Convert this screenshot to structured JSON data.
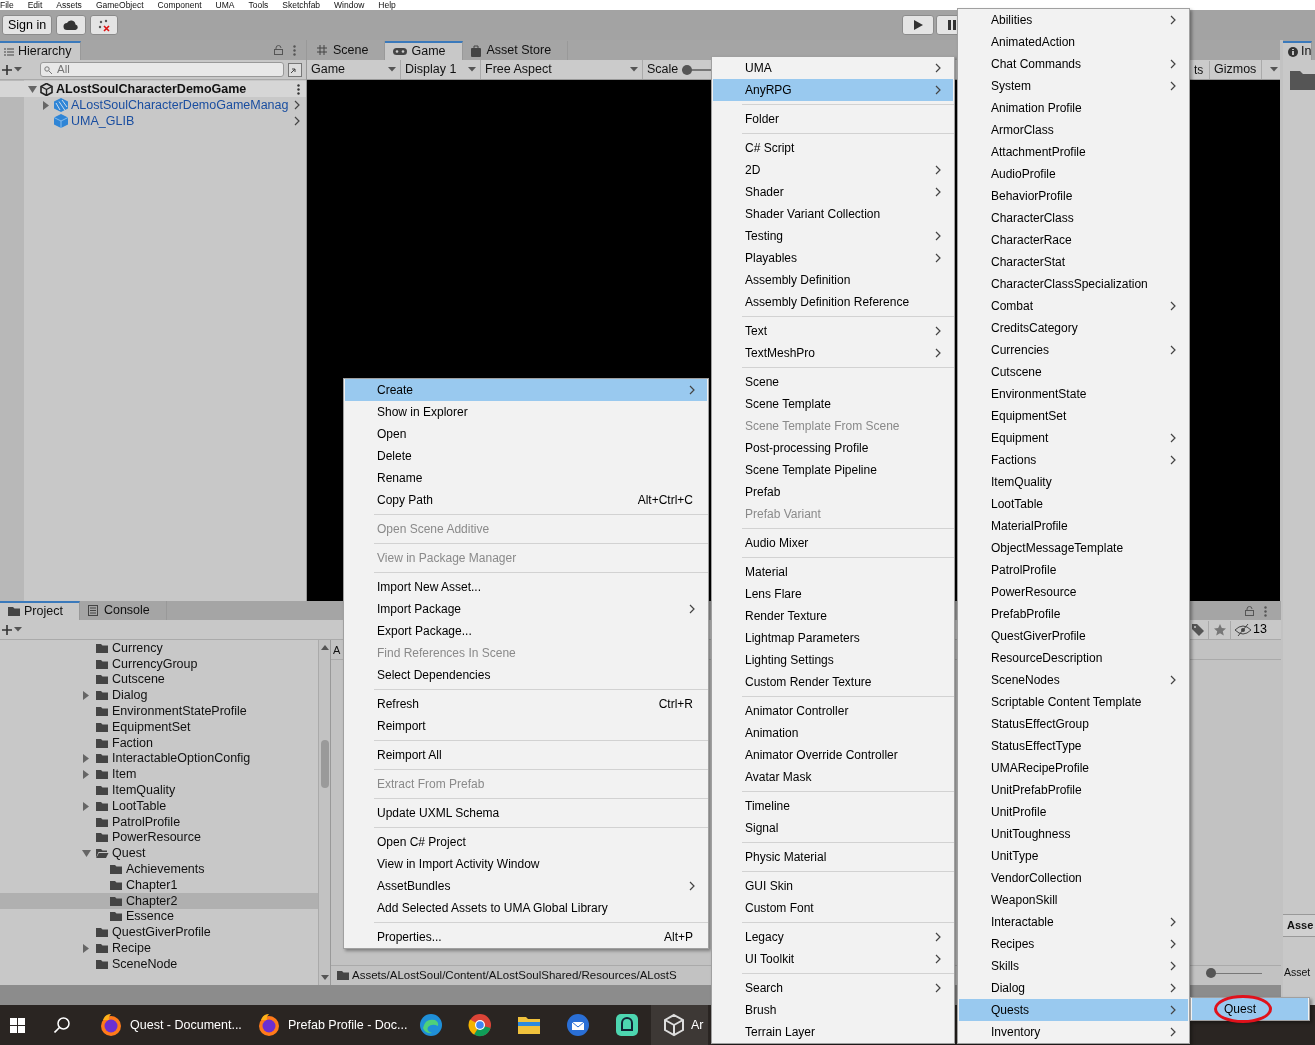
{
  "menu_bar": [
    "File",
    "Edit",
    "Assets",
    "GameObject",
    "Component",
    "UMA",
    "Tools",
    "Sketchfab",
    "Window",
    "Help"
  ],
  "toolbar": {
    "sign_in": "Sign in"
  },
  "hierarchy": {
    "title": "Hierarchy",
    "search_placeholder": "All",
    "tree": [
      {
        "name": "ALostSoulCharacterDemoGame",
        "kind": "scene",
        "expandable": true,
        "expanded": true,
        "children": [
          {
            "name": "ALostSoulCharacterDemoGameManag",
            "kind": "variant",
            "expandable": true,
            "expanded": false
          },
          {
            "name": "UMA_GLIB",
            "kind": "prefab",
            "expandable": false
          }
        ]
      }
    ]
  },
  "game_view": {
    "tabs": [
      {
        "label": "Scene",
        "kind": "grid",
        "selected": false
      },
      {
        "label": "Game",
        "kind": "pad",
        "selected": true
      },
      {
        "label": "Asset Store",
        "kind": "bag",
        "selected": false
      }
    ],
    "mode": "Game",
    "display": "Display 1",
    "aspect": "Free Aspect",
    "scale_label": "Scale",
    "scale_slider": {
      "level": 0
    },
    "stats": "ts",
    "gizmos": "Gizmos"
  },
  "inspector": {
    "title": "In",
    "section_heading": "Asse",
    "label": "Asset"
  },
  "project": {
    "tabs": [
      {
        "label": "Project",
        "kind": "folder",
        "selected": true
      },
      {
        "label": "Console",
        "kind": "console",
        "selected": false
      }
    ],
    "hidden_count": "13",
    "column_label": "A",
    "path": "Assets/ALostSoul/Content/ALostSoulShared/Resources/ALostS",
    "zoom_slider": {
      "level": 0
    },
    "tree": [
      {
        "name": "Currency",
        "expandable": false,
        "expanded": false,
        "selected": false
      },
      {
        "name": "CurrencyGroup",
        "expandable": false,
        "expanded": false,
        "selected": false
      },
      {
        "name": "Cutscene",
        "expandable": false,
        "expanded": false,
        "selected": false
      },
      {
        "name": "Dialog",
        "expandable": true,
        "expanded": false,
        "selected": false
      },
      {
        "name": "EnvironmentStateProfile",
        "expandable": false,
        "expanded": false,
        "selected": false
      },
      {
        "name": "EquipmentSet",
        "expandable": false,
        "expanded": false,
        "selected": false
      },
      {
        "name": "Faction",
        "expandable": false,
        "expanded": false,
        "selected": false
      },
      {
        "name": "InteractableOptionConfig",
        "expandable": true,
        "expanded": false,
        "selected": false
      },
      {
        "name": "Item",
        "expandable": true,
        "expanded": false,
        "selected": false
      },
      {
        "name": "ItemQuality",
        "expandable": false,
        "expanded": false,
        "selected": false
      },
      {
        "name": "LootTable",
        "expandable": true,
        "expanded": false,
        "selected": false
      },
      {
        "name": "PatrolProfile",
        "expandable": false,
        "expanded": false,
        "selected": false
      },
      {
        "name": "PowerResource",
        "expandable": false,
        "expanded": false,
        "selected": false
      },
      {
        "name": "Quest",
        "expandable": true,
        "expanded": true,
        "selected": false,
        "children": [
          {
            "name": "Achievements",
            "expandable": false,
            "expanded": false,
            "selected": false
          },
          {
            "name": "Chapter1",
            "expandable": false,
            "expanded": false,
            "selected": false
          },
          {
            "name": "Chapter2",
            "expandable": false,
            "expanded": false,
            "selected": true
          },
          {
            "name": "Essence",
            "expandable": false,
            "expanded": false,
            "selected": false
          }
        ]
      },
      {
        "name": "QuestGiverProfile",
        "expandable": false,
        "expanded": false,
        "selected": false
      },
      {
        "name": "Recipe",
        "expandable": true,
        "expanded": false,
        "selected": false
      },
      {
        "name": "SceneNode",
        "expandable": false,
        "expanded": false,
        "selected": false
      }
    ]
  },
  "context_menu": {
    "items": [
      {
        "kind": "item",
        "label": "Create",
        "submenu": true,
        "selected": true,
        "disabled": false
      },
      {
        "kind": "item",
        "label": "Show in Explorer",
        "submenu": false,
        "selected": false,
        "disabled": false
      },
      {
        "kind": "item",
        "label": "Open",
        "submenu": false,
        "selected": false,
        "disabled": false
      },
      {
        "kind": "item",
        "label": "Delete",
        "submenu": false,
        "selected": false,
        "disabled": false
      },
      {
        "kind": "item",
        "label": "Rename",
        "submenu": false,
        "selected": false,
        "disabled": false
      },
      {
        "kind": "item",
        "label": "Copy Path",
        "shortcut": "Alt+Ctrl+C",
        "submenu": false,
        "selected": false,
        "disabled": false
      },
      {
        "kind": "separator"
      },
      {
        "kind": "item",
        "label": "Open Scene Additive",
        "submenu": false,
        "selected": false,
        "disabled": true
      },
      {
        "kind": "separator"
      },
      {
        "kind": "item",
        "label": "View in Package Manager",
        "submenu": false,
        "selected": false,
        "disabled": true
      },
      {
        "kind": "separator"
      },
      {
        "kind": "item",
        "label": "Import New Asset...",
        "submenu": false,
        "selected": false,
        "disabled": false
      },
      {
        "kind": "item",
        "label": "Import Package",
        "submenu": true,
        "selected": false,
        "disabled": false
      },
      {
        "kind": "item",
        "label": "Export Package...",
        "submenu": false,
        "selected": false,
        "disabled": false
      },
      {
        "kind": "item",
        "label": "Find References In Scene",
        "submenu": false,
        "selected": false,
        "disabled": true
      },
      {
        "kind": "item",
        "label": "Select Dependencies",
        "submenu": false,
        "selected": false,
        "disabled": false
      },
      {
        "kind": "separator"
      },
      {
        "kind": "item",
        "label": "Refresh",
        "shortcut": "Ctrl+R",
        "submenu": false,
        "selected": false,
        "disabled": false
      },
      {
        "kind": "item",
        "label": "Reimport",
        "submenu": false,
        "selected": false,
        "disabled": false
      },
      {
        "kind": "separator"
      },
      {
        "kind": "item",
        "label": "Reimport All",
        "submenu": false,
        "selected": false,
        "disabled": false
      },
      {
        "kind": "separator"
      },
      {
        "kind": "item",
        "label": "Extract From Prefab",
        "submenu": false,
        "selected": false,
        "disabled": true
      },
      {
        "kind": "separator"
      },
      {
        "kind": "item",
        "label": "Update UXML Schema",
        "submenu": false,
        "selected": false,
        "disabled": false
      },
      {
        "kind": "separator"
      },
      {
        "kind": "item",
        "label": "Open C# Project",
        "submenu": false,
        "selected": false,
        "disabled": false
      },
      {
        "kind": "item",
        "label": "View in Import Activity Window",
        "submenu": false,
        "selected": false,
        "disabled": false
      },
      {
        "kind": "item",
        "label": "AssetBundles",
        "submenu": true,
        "selected": false,
        "disabled": false
      },
      {
        "kind": "item",
        "label": "Add Selected Assets to UMA Global Library",
        "submenu": false,
        "selected": false,
        "disabled": false
      },
      {
        "kind": "separator"
      },
      {
        "kind": "item",
        "label": "Properties...",
        "shortcut": "Alt+P",
        "submenu": false,
        "selected": false,
        "disabled": false
      }
    ]
  },
  "create_menu": {
    "items": [
      {
        "kind": "item",
        "label": "UMA",
        "submenu": true,
        "selected": false,
        "disabled": false
      },
      {
        "kind": "item",
        "label": "AnyRPG",
        "submenu": true,
        "selected": true,
        "disabled": false
      },
      {
        "kind": "separator"
      },
      {
        "kind": "item",
        "label": "Folder",
        "submenu": false,
        "selected": false,
        "disabled": false
      },
      {
        "kind": "separator"
      },
      {
        "kind": "item",
        "label": "C# Script",
        "submenu": false,
        "selected": false,
        "disabled": false
      },
      {
        "kind": "item",
        "label": "2D",
        "submenu": true,
        "selected": false,
        "disabled": false
      },
      {
        "kind": "item",
        "label": "Shader",
        "submenu": true,
        "selected": false,
        "disabled": false
      },
      {
        "kind": "item",
        "label": "Shader Variant Collection",
        "submenu": false,
        "selected": false,
        "disabled": false
      },
      {
        "kind": "item",
        "label": "Testing",
        "submenu": true,
        "selected": false,
        "disabled": false
      },
      {
        "kind": "item",
        "label": "Playables",
        "submenu": true,
        "selected": false,
        "disabled": false
      },
      {
        "kind": "item",
        "label": "Assembly Definition",
        "submenu": false,
        "selected": false,
        "disabled": false
      },
      {
        "kind": "item",
        "label": "Assembly Definition Reference",
        "submenu": false,
        "selected": false,
        "disabled": false
      },
      {
        "kind": "separator"
      },
      {
        "kind": "item",
        "label": "Text",
        "submenu": true,
        "selected": false,
        "disabled": false
      },
      {
        "kind": "item",
        "label": "TextMeshPro",
        "submenu": true,
        "selected": false,
        "disabled": false
      },
      {
        "kind": "separator"
      },
      {
        "kind": "item",
        "label": "Scene",
        "submenu": false,
        "selected": false,
        "disabled": false
      },
      {
        "kind": "item",
        "label": "Scene Template",
        "submenu": false,
        "selected": false,
        "disabled": false
      },
      {
        "kind": "item",
        "label": "Scene Template From Scene",
        "submenu": false,
        "selected": false,
        "disabled": true
      },
      {
        "kind": "item",
        "label": "Post-processing Profile",
        "submenu": false,
        "selected": false,
        "disabled": false
      },
      {
        "kind": "item",
        "label": "Scene Template Pipeline",
        "submenu": false,
        "selected": false,
        "disabled": false
      },
      {
        "kind": "item",
        "label": "Prefab",
        "submenu": false,
        "selected": false,
        "disabled": false
      },
      {
        "kind": "item",
        "label": "Prefab Variant",
        "submenu": false,
        "selected": false,
        "disabled": true
      },
      {
        "kind": "separator"
      },
      {
        "kind": "item",
        "label": "Audio Mixer",
        "submenu": false,
        "selected": false,
        "disabled": false
      },
      {
        "kind": "separator"
      },
      {
        "kind": "item",
        "label": "Material",
        "submenu": false,
        "selected": false,
        "disabled": false
      },
      {
        "kind": "item",
        "label": "Lens Flare",
        "submenu": false,
        "selected": false,
        "disabled": false
      },
      {
        "kind": "item",
        "label": "Render Texture",
        "submenu": false,
        "selected": false,
        "disabled": false
      },
      {
        "kind": "item",
        "label": "Lightmap Parameters",
        "submenu": false,
        "selected": false,
        "disabled": false
      },
      {
        "kind": "item",
        "label": "Lighting Settings",
        "submenu": false,
        "selected": false,
        "disabled": false
      },
      {
        "kind": "item",
        "label": "Custom Render Texture",
        "submenu": false,
        "selected": false,
        "disabled": false
      },
      {
        "kind": "separator"
      },
      {
        "kind": "item",
        "label": "Animator Controller",
        "submenu": false,
        "selected": false,
        "disabled": false
      },
      {
        "kind": "item",
        "label": "Animation",
        "submenu": false,
        "selected": false,
        "disabled": false
      },
      {
        "kind": "item",
        "label": "Animator Override Controller",
        "submenu": false,
        "selected": false,
        "disabled": false
      },
      {
        "kind": "item",
        "label": "Avatar Mask",
        "submenu": false,
        "selected": false,
        "disabled": false
      },
      {
        "kind": "separator"
      },
      {
        "kind": "item",
        "label": "Timeline",
        "submenu": false,
        "selected": false,
        "disabled": false
      },
      {
        "kind": "item",
        "label": "Signal",
        "submenu": false,
        "selected": false,
        "disabled": false
      },
      {
        "kind": "separator"
      },
      {
        "kind": "item",
        "label": "Physic Material",
        "submenu": false,
        "selected": false,
        "disabled": false
      },
      {
        "kind": "separator"
      },
      {
        "kind": "item",
        "label": "GUI Skin",
        "submenu": false,
        "selected": false,
        "disabled": false
      },
      {
        "kind": "item",
        "label": "Custom Font",
        "submenu": false,
        "selected": false,
        "disabled": false
      },
      {
        "kind": "separator"
      },
      {
        "kind": "item",
        "label": "Legacy",
        "submenu": true,
        "selected": false,
        "disabled": false
      },
      {
        "kind": "item",
        "label": "UI Toolkit",
        "submenu": true,
        "selected": false,
        "disabled": false
      },
      {
        "kind": "separator"
      },
      {
        "kind": "item",
        "label": "Search",
        "submenu": true,
        "selected": false,
        "disabled": false
      },
      {
        "kind": "item",
        "label": "Brush",
        "submenu": false,
        "selected": false,
        "disabled": false
      },
      {
        "kind": "item",
        "label": "Terrain Layer",
        "submenu": false,
        "selected": false,
        "disabled": false
      }
    ]
  },
  "anyrpg_menu": {
    "items": [
      {
        "kind": "item",
        "label": "Abilities",
        "submenu": true,
        "selected": false,
        "disabled": false
      },
      {
        "kind": "item",
        "label": "AnimatedAction",
        "submenu": false,
        "selected": false,
        "disabled": false
      },
      {
        "kind": "item",
        "label": "Chat Commands",
        "submenu": true,
        "selected": false,
        "disabled": false
      },
      {
        "kind": "item",
        "label": "System",
        "submenu": true,
        "selected": false,
        "disabled": false
      },
      {
        "kind": "item",
        "label": "Animation Profile",
        "submenu": false,
        "selected": false,
        "disabled": false
      },
      {
        "kind": "item",
        "label": "ArmorClass",
        "submenu": false,
        "selected": false,
        "disabled": false
      },
      {
        "kind": "item",
        "label": "AttachmentProfile",
        "submenu": false,
        "selected": false,
        "disabled": false
      },
      {
        "kind": "item",
        "label": "AudioProfile",
        "submenu": false,
        "selected": false,
        "disabled": false
      },
      {
        "kind": "item",
        "label": "BehaviorProfile",
        "submenu": false,
        "selected": false,
        "disabled": false
      },
      {
        "kind": "item",
        "label": "CharacterClass",
        "submenu": false,
        "selected": false,
        "disabled": false
      },
      {
        "kind": "item",
        "label": "CharacterRace",
        "submenu": false,
        "selected": false,
        "disabled": false
      },
      {
        "kind": "item",
        "label": "CharacterStat",
        "submenu": false,
        "selected": false,
        "disabled": false
      },
      {
        "kind": "item",
        "label": "CharacterClassSpecialization",
        "submenu": false,
        "selected": false,
        "disabled": false
      },
      {
        "kind": "item",
        "label": "Combat",
        "submenu": true,
        "selected": false,
        "disabled": false
      },
      {
        "kind": "item",
        "label": "CreditsCategory",
        "submenu": false,
        "selected": false,
        "disabled": false
      },
      {
        "kind": "item",
        "label": "Currencies",
        "submenu": true,
        "selected": false,
        "disabled": false
      },
      {
        "kind": "item",
        "label": "Cutscene",
        "submenu": false,
        "selected": false,
        "disabled": false
      },
      {
        "kind": "item",
        "label": "EnvironmentState",
        "submenu": false,
        "selected": false,
        "disabled": false
      },
      {
        "kind": "item",
        "label": "EquipmentSet",
        "submenu": false,
        "selected": false,
        "disabled": false
      },
      {
        "kind": "item",
        "label": "Equipment",
        "submenu": true,
        "selected": false,
        "disabled": false
      },
      {
        "kind": "item",
        "label": "Factions",
        "submenu": true,
        "selected": false,
        "disabled": false
      },
      {
        "kind": "item",
        "label": "ItemQuality",
        "submenu": false,
        "selected": false,
        "disabled": false
      },
      {
        "kind": "item",
        "label": "LootTable",
        "submenu": false,
        "selected": false,
        "disabled": false
      },
      {
        "kind": "item",
        "label": "MaterialProfile",
        "submenu": false,
        "selected": false,
        "disabled": false
      },
      {
        "kind": "item",
        "label": "ObjectMessageTemplate",
        "submenu": false,
        "selected": false,
        "disabled": false
      },
      {
        "kind": "item",
        "label": "PatrolProfile",
        "submenu": false,
        "selected": false,
        "disabled": false
      },
      {
        "kind": "item",
        "label": "PowerResource",
        "submenu": false,
        "selected": false,
        "disabled": false
      },
      {
        "kind": "item",
        "label": "PrefabProfile",
        "submenu": false,
        "selected": false,
        "disabled": false
      },
      {
        "kind": "item",
        "label": "QuestGiverProfile",
        "submenu": false,
        "selected": false,
        "disabled": false
      },
      {
        "kind": "item",
        "label": "ResourceDescription",
        "submenu": false,
        "selected": false,
        "disabled": false
      },
      {
        "kind": "item",
        "label": "SceneNodes",
        "submenu": true,
        "selected": false,
        "disabled": false
      },
      {
        "kind": "item",
        "label": "Scriptable Content Template",
        "submenu": false,
        "selected": false,
        "disabled": false
      },
      {
        "kind": "item",
        "label": "StatusEffectGroup",
        "submenu": false,
        "selected": false,
        "disabled": false
      },
      {
        "kind": "item",
        "label": "StatusEffectType",
        "submenu": false,
        "selected": false,
        "disabled": false
      },
      {
        "kind": "item",
        "label": "UMARecipeProfile",
        "submenu": false,
        "selected": false,
        "disabled": false
      },
      {
        "kind": "item",
        "label": "UnitPrefabProfile",
        "submenu": false,
        "selected": false,
        "disabled": false
      },
      {
        "kind": "item",
        "label": "UnitProfile",
        "submenu": false,
        "selected": false,
        "disabled": false
      },
      {
        "kind": "item",
        "label": "UnitToughness",
        "submenu": false,
        "selected": false,
        "disabled": false
      },
      {
        "kind": "item",
        "label": "UnitType",
        "submenu": false,
        "selected": false,
        "disabled": false
      },
      {
        "kind": "item",
        "label": "VendorCollection",
        "submenu": false,
        "selected": false,
        "disabled": false
      },
      {
        "kind": "item",
        "label": "WeaponSkill",
        "submenu": false,
        "selected": false,
        "disabled": false
      },
      {
        "kind": "item",
        "label": "Interactable",
        "submenu": true,
        "selected": false,
        "disabled": false
      },
      {
        "kind": "item",
        "label": "Recipes",
        "submenu": true,
        "selected": false,
        "disabled": false
      },
      {
        "kind": "item",
        "label": "Skills",
        "submenu": true,
        "selected": false,
        "disabled": false
      },
      {
        "kind": "item",
        "label": "Dialog",
        "submenu": true,
        "selected": false,
        "disabled": false
      },
      {
        "kind": "item",
        "label": "Quests",
        "submenu": true,
        "selected": true,
        "disabled": false
      },
      {
        "kind": "item",
        "label": "Inventory",
        "submenu": true,
        "selected": false,
        "disabled": false
      }
    ]
  },
  "quests_menu": {
    "items": [
      {
        "kind": "item",
        "label": "Quest",
        "submenu": false,
        "selected": true,
        "disabled": false,
        "circled": true
      }
    ]
  },
  "taskbar": {
    "windows": [
      {
        "kind": "browser",
        "label": "Quest - Document..."
      },
      {
        "kind": "browser",
        "label": "Prefab Profile - Doc..."
      }
    ],
    "pinned": [
      {
        "kind": "swirl"
      },
      {
        "kind": "ring"
      },
      {
        "kind": "folder"
      },
      {
        "kind": "mail"
      },
      {
        "kind": "chat"
      },
      {
        "kind": "cube",
        "label": "Ar"
      }
    ]
  }
}
